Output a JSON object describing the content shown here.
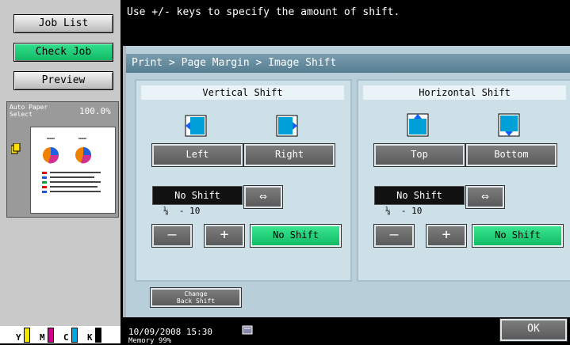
{
  "sidebar": {
    "job_list": "Job List",
    "check_job": "Check Job",
    "preview": "Preview",
    "paper_label_1": "Auto Paper",
    "paper_label_2": "Select",
    "zoom": "100.0%",
    "toner": [
      {
        "label": "Y",
        "color": "#f2e600"
      },
      {
        "label": "M",
        "color": "#d0008a"
      },
      {
        "label": "C",
        "color": "#00a8e0"
      },
      {
        "label": "K",
        "color": "#000000"
      }
    ]
  },
  "message": "Use +/- keys to specify the amount of shift.",
  "breadcrumb": "Print > Page Margin > Image Shift",
  "vertical": {
    "title": "Vertical Shift",
    "left": "Left",
    "right": "Right",
    "display": "No Shift",
    "unit_fraction": "⅛",
    "unit_range": "-  10",
    "minus": "–",
    "plus": "+",
    "no_shift": "No Shift"
  },
  "horizontal": {
    "title": "Horizontal Shift",
    "top": "Top",
    "bottom": "Bottom",
    "display": "No Shift",
    "unit_fraction": "⅛",
    "unit_range": "-  10",
    "minus": "–",
    "plus": "+",
    "no_shift": "No Shift"
  },
  "swap_symbol": "⇔",
  "change_back_1": "Change",
  "change_back_2": "Back Shift",
  "datetime": "10/09/2008    15:30",
  "memory": "Memory           99%",
  "ok": "OK"
}
